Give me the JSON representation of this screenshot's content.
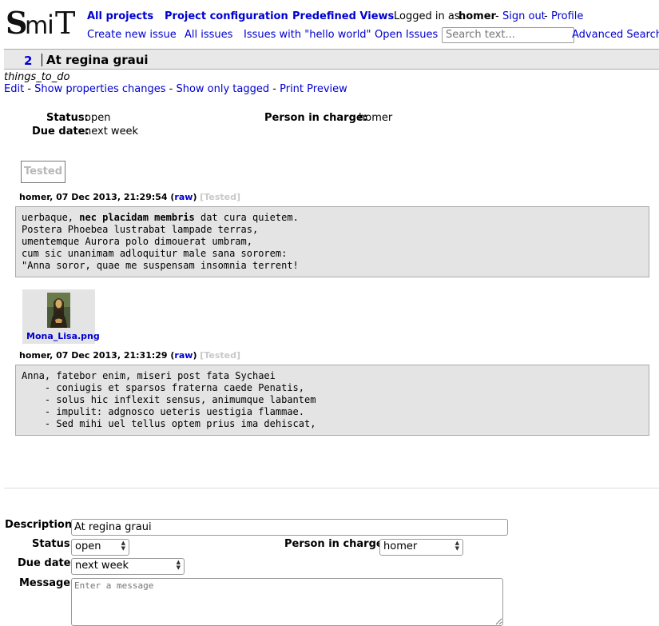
{
  "logo": {
    "text": "SmiT"
  },
  "nav": {
    "all_projects": "All projects",
    "project_configuration": "Project configuration",
    "predefined_views": "Predefined Views",
    "logged_in_as": "Logged in as:",
    "username": "homer",
    "sep1": "-",
    "sign_out": "Sign out",
    "sep2": "-",
    "profile": "Profile",
    "create_new_issue": "Create new issue",
    "all_issues": "All issues",
    "issues_hello": "Issues with \"hello world\"",
    "open_issues": "Open Issues",
    "search_placeholder": "Search text...",
    "advanced_search": "Advanced Search"
  },
  "issue": {
    "id": "2",
    "title": "At regina graui",
    "project": "things_to_do",
    "actions": {
      "edit": "Edit",
      "sep1": "-",
      "show_properties": "Show properties changes",
      "sep2": "-",
      "show_tagged": "Show only tagged",
      "sep3": "-",
      "print_preview": "Print Preview"
    },
    "properties": {
      "status_label": "Status:",
      "status_value": "open",
      "due_label": "Due date:",
      "due_value": "next week",
      "person_label": "Person in charge:",
      "person_value": "homer"
    },
    "tag": "Tested"
  },
  "messages": [
    {
      "author_date": "homer, 07 Dec 2013, 21:29:54",
      "raw": "raw",
      "tag": "[Tested]",
      "lines_pre": "uerbaque, ",
      "bold": "nec placidam membris",
      "lines_post": " dat cura quietem.\nPostera Phoebea lustrabat lampade terras,\numentemque Aurora polo dimouerat umbram,\ncum sic unanimam adloquitur male sana sororem:\n\"Anna soror, quae me suspensam insomnia terrent!"
    },
    {
      "author_date": "homer, 07 Dec 2013, 21:31:29",
      "raw": "raw",
      "tag": "[Tested]",
      "body": "Anna, fatebor enim, miseri post fata Sychaei\n    - coniugis et sparsos fraterna caede Penatis,\n    - solus hic inflexit sensus, animumque labantem\n    - impulit: adgnosco ueteris uestigia flammae.\n    - Sed mihi uel tellus optem prius ima dehiscat,"
    }
  ],
  "attachment": {
    "filename": "Mona_Lisa.png"
  },
  "form": {
    "description_label": "Description:",
    "description_value": "At regina graui",
    "status_label": "Status:",
    "status_value": "open",
    "person_label": "Person in charge:",
    "person_value": "homer",
    "due_label": "Due date:",
    "due_value": "next week",
    "message_label": "Message:",
    "message_placeholder": "Enter a message"
  },
  "colors": {
    "link": "#0000d0",
    "box_bg": "#e4e4e4",
    "tag_muted": "#c8c8c8"
  }
}
